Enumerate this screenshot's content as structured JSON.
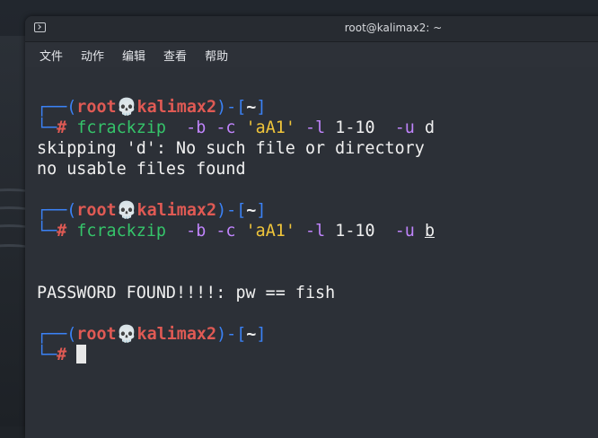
{
  "window": {
    "title": "root@kalimax2: ~"
  },
  "menu": [
    "文件",
    "动作",
    "编辑",
    "查看",
    "帮助"
  ],
  "prompt": {
    "corner_top": "┌──(",
    "user": "root",
    "skull": "💀",
    "host": "kalimax2",
    "mid": ")-[",
    "dir": "~",
    "end": "]",
    "corner_bottom": "└─",
    "hash": "#"
  },
  "session": {
    "cmd1": {
      "program": "fcrackzip",
      "flag_b": "-b",
      "flag_c": "-c",
      "charset": "'aA1'",
      "flag_l": "-l",
      "length": "1-10",
      "flag_u": "-u",
      "file": "d"
    },
    "out1_line1": "skipping 'd': No such file or directory",
    "out1_line2": "no usable files found",
    "cmd2": {
      "program": "fcrackzip",
      "flag_b": "-b",
      "flag_c": "-c",
      "charset": "'aA1'",
      "flag_l": "-l",
      "length": "1-10",
      "flag_u": "-u",
      "file": "b"
    },
    "out2_line1": "PASSWORD FOUND!!!!: pw == fish"
  },
  "colors": {
    "prompt_blue": "#3b82f6",
    "prompt_red": "#e05a54",
    "command_green": "#35c46a",
    "flag_purple": "#c084fc",
    "string_yellow": "#f0c53a",
    "terminal_bg": "#2c3037"
  }
}
